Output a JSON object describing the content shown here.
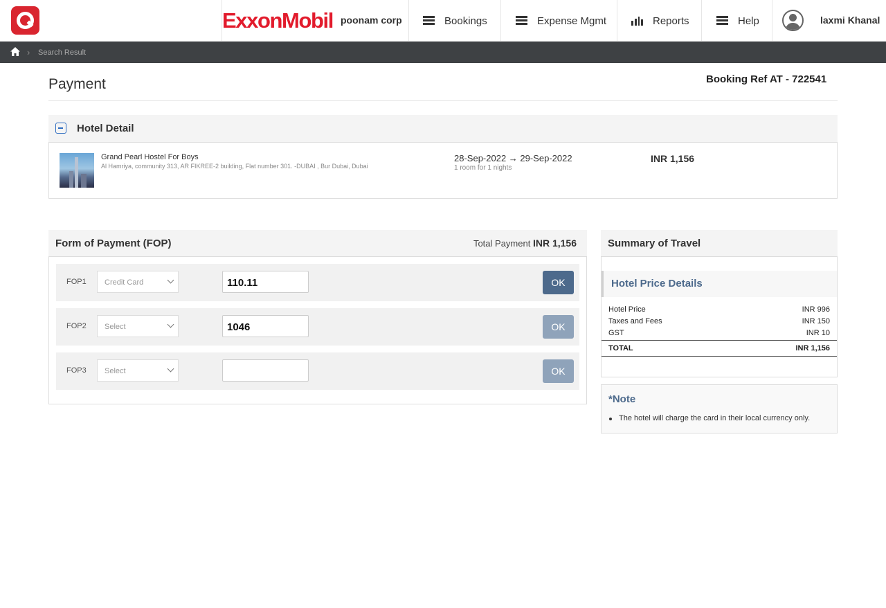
{
  "header": {
    "brand_name": "ExxonMobil",
    "company": "poonam corp",
    "nav": [
      {
        "label": "Bookings",
        "icon": "menu-icon"
      },
      {
        "label": "Expense Mgmt",
        "icon": "menu-icon"
      },
      {
        "label": "Reports",
        "icon": "bar-chart-icon"
      },
      {
        "label": "Help",
        "icon": "menu-icon"
      }
    ],
    "user_name": "laxmi Khanal"
  },
  "breadcrumb": {
    "current": "Search Result"
  },
  "page": {
    "title": "Payment",
    "booking_ref": "Booking Ref AT - 722541"
  },
  "hotel_detail": {
    "section_title": "Hotel Detail",
    "name": "Grand Pearl Hostel For Boys",
    "address": "Al Hamriya, community 313, AR FIKREE-2 building, Flat number 301. -DUBAI , Bur Dubai, Dubai",
    "dates": "28-Sep-2022 → 29-Sep-2022",
    "rooms_nights": "1 room for 1 nights",
    "price": "INR 1,156"
  },
  "fop": {
    "title": "Form of Payment (FOP)",
    "total_label": "Total Payment",
    "total_value": "INR 1,156",
    "rows": [
      {
        "label": "FOP1",
        "select_value": "Credit Card",
        "amount": "110.11",
        "ok_label": "OK",
        "ok_state": "active"
      },
      {
        "label": "FOP2",
        "select_value": "Select",
        "amount": "1046",
        "ok_label": "OK",
        "ok_state": "disabled"
      },
      {
        "label": "FOP3",
        "select_value": "Select",
        "amount": "",
        "ok_label": "OK",
        "ok_state": "disabled"
      }
    ]
  },
  "summary": {
    "title": "Summary of Travel",
    "section_title": "Hotel Price Details",
    "items": [
      {
        "label": "Hotel Price",
        "value": "INR 996"
      },
      {
        "label": "Taxes and Fees",
        "value": "INR 150"
      },
      {
        "label": "GST",
        "value": "INR 10"
      }
    ],
    "total_label": "TOTAL",
    "total_value": "INR 1,156"
  },
  "note": {
    "title": "*Note",
    "text": "The hotel will charge the card in their local currency only."
  },
  "colors": {
    "brand_red": "#e21b2c",
    "logo_red": "#d9252f",
    "ok_active": "#4d6a8c",
    "ok_disabled": "#8fa3ba",
    "breadcrumb_bg": "#3e4144"
  }
}
